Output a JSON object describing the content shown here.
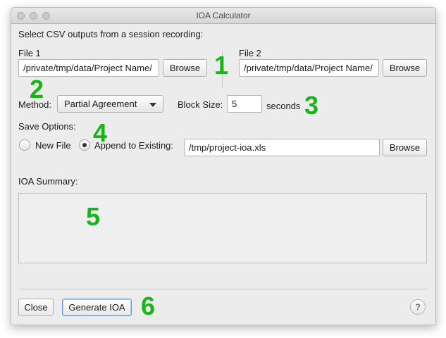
{
  "window": {
    "title": "IOA Calculator"
  },
  "header": {
    "instructions": "Select CSV outputs from a session recording:"
  },
  "file1": {
    "label": "File 1",
    "value": "/private/tmp/data/Project Name/",
    "browse_label": "Browse"
  },
  "file2": {
    "label": "File 2",
    "value": "/private/tmp/data/Project Name/",
    "browse_label": "Browse"
  },
  "method": {
    "label": "Method:",
    "selected": "Partial Agreement"
  },
  "block_size": {
    "label": "Block Size:",
    "value": "5",
    "unit": "seconds"
  },
  "save_options": {
    "label": "Save Options:",
    "new_file_label": "New File",
    "append_label": "Append to Existing:",
    "selected": "append",
    "path_value": "/tmp/project-ioa.xls",
    "browse_label": "Browse"
  },
  "summary": {
    "label": "IOA Summary:"
  },
  "footer": {
    "close_label": "Close",
    "generate_label": "Generate IOA",
    "help_label": "?"
  },
  "annotations": [
    "1",
    "2",
    "3",
    "4",
    "5",
    "6"
  ],
  "colors": {
    "annotation": "#17b517",
    "window_bg": "#ececec"
  }
}
